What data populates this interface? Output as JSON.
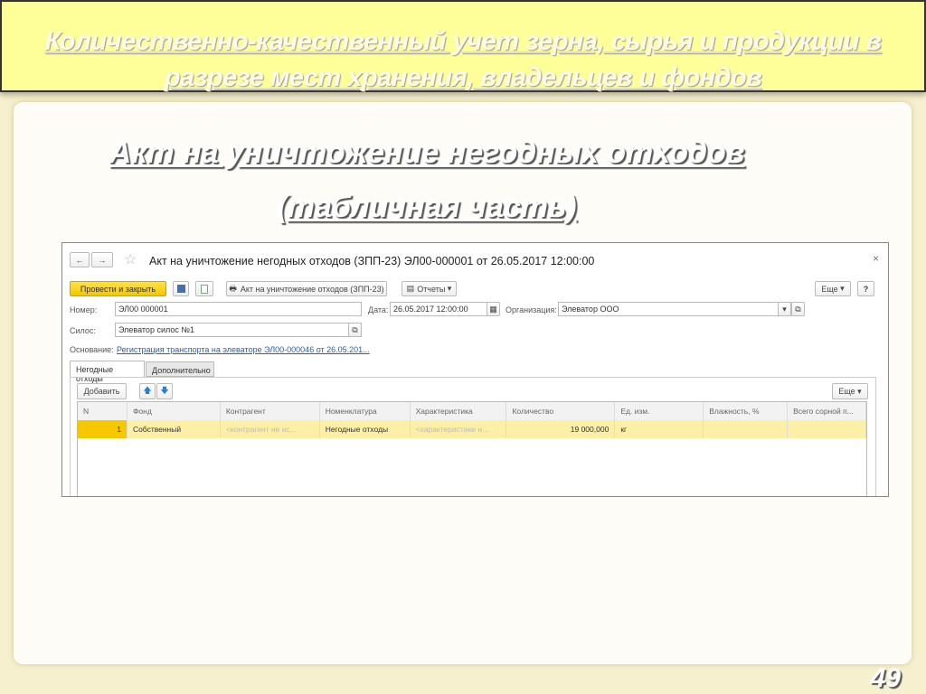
{
  "slide": {
    "title_line1": "Количественно-качественный учет зерна, сырья и продукции в",
    "title_line2": "разрезе мест хранения, владельцев и фондов",
    "subtitle1": "Акт на уничтожение негодных отходов",
    "subtitle2": "(табличная часть)",
    "page_number": "49"
  },
  "window": {
    "title": "Акт на уничтожение негодных отходов (ЗПП-23) ЭЛ00-000001 от 26.05.2017 12:00:00",
    "back": "←",
    "forward": "→",
    "star": "☆",
    "close": "×"
  },
  "toolbar": {
    "post_close": "Провести и закрыть",
    "print_label": "Акт на уничтожение отходов (ЗПП-23)",
    "reports": "Отчеты",
    "more": "Еще",
    "help": "?"
  },
  "form": {
    "number_label": "Номер:",
    "number_value": "ЭЛ00 000001",
    "date_label": "Дата:",
    "date_value": "26.05.2017 12:00:00",
    "org_label": "Организация:",
    "org_value": "Элеватор ООО",
    "silo_label": "Силос:",
    "silo_value": "Элеватор силос №1",
    "basis_label": "Основание:",
    "basis_link": "Регистрация транспорта на элеваторе ЭЛ00-000046 от 26.05.201..."
  },
  "tabs": [
    {
      "label": "Негодные отходы"
    },
    {
      "label": "Дополнительно"
    }
  ],
  "table": {
    "add": "Добавить",
    "more": "Еще",
    "columns": [
      "N",
      "Фонд",
      "Контрагент",
      "Номенклатура",
      "Характеристика",
      "Количество",
      "Ед. изм.",
      "Влажность, %",
      "Всего сорной п..."
    ],
    "rows": [
      [
        "1",
        "Собственный",
        "<контрагент не ис...",
        "Негодные отходы",
        "<характеристики н...",
        "19 000,000",
        "кг",
        "",
        ""
      ]
    ]
  }
}
